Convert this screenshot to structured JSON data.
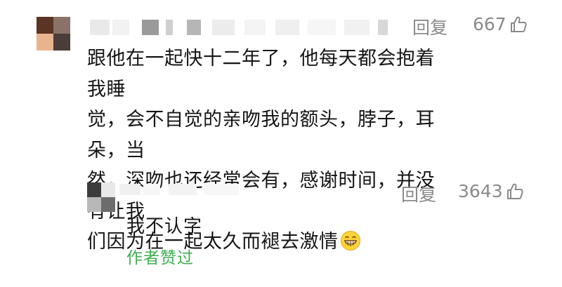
{
  "comment": {
    "avatar_icon": "user-avatar-blurred",
    "reply_label": "回复",
    "like_count": "667",
    "like_icon": "thumbs-up-icon",
    "text": "跟他在一起快十二年了，他每天都会抱着我睡觉，会不自觉的亲吻我的额头，脖子，耳朵，当然，深吻也还经常会有，感谢时间，并没有让我们因为在一起太久而褪去激情",
    "lines": [
      "跟他在一起快十二年了，他每天都会抱着我睡",
      "觉，会不自觉的亲吻我的额头，脖子，耳朵，当",
      "然，深吻也还经常会有，感谢时间，并没有让我",
      "们因为在一起太久而褪去激情"
    ],
    "emoji_icon": "grinning-emoji-icon"
  },
  "reply": {
    "avatar_icon": "user-avatar-blurred",
    "reply_label": "回复",
    "like_count": "3643",
    "like_icon": "thumbs-up-icon",
    "text": "我不认字",
    "author_liked": "作者赞过"
  },
  "colors": {
    "action_gray": "#8a8a8a",
    "author_liked_green": "#3fae4f",
    "text": "#151515"
  }
}
